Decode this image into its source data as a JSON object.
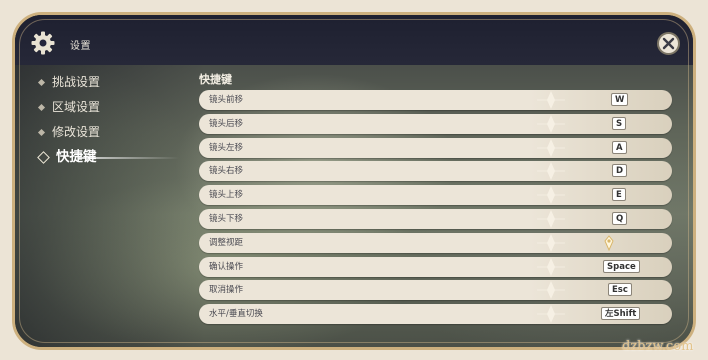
{
  "window": {
    "title": "设置",
    "close_icon": "close-icon"
  },
  "sidebar": {
    "items": [
      {
        "label": "挑战设置",
        "active": false
      },
      {
        "label": "区域设置",
        "active": false
      },
      {
        "label": "修改设置",
        "active": false
      },
      {
        "label": "快捷键",
        "active": true
      }
    ]
  },
  "main": {
    "section_title": "快捷键",
    "rows": [
      {
        "label": "镜头前移",
        "key": "W"
      },
      {
        "label": "镜头后移",
        "key": "S"
      },
      {
        "label": "镜头左移",
        "key": "A"
      },
      {
        "label": "镜头右移",
        "key": "D"
      },
      {
        "label": "镜头上移",
        "key": "E"
      },
      {
        "label": "镜头下移",
        "key": "Q"
      },
      {
        "label": "调整视距",
        "key": "",
        "key_icon": "mouse-scroll-icon"
      },
      {
        "label": "确认操作",
        "key": "Space"
      },
      {
        "label": "取消操作",
        "key": "Esc"
      },
      {
        "label": "水平/垂直切换",
        "key": "左Shift"
      }
    ]
  },
  "watermark": "dzbzw.com",
  "colors": {
    "row_bg": "#ece5d8",
    "frame_gold": "#cdb07e",
    "topbar": "#1e2030",
    "text_light": "#e9e4d8",
    "row_text": "#4a4a52"
  }
}
